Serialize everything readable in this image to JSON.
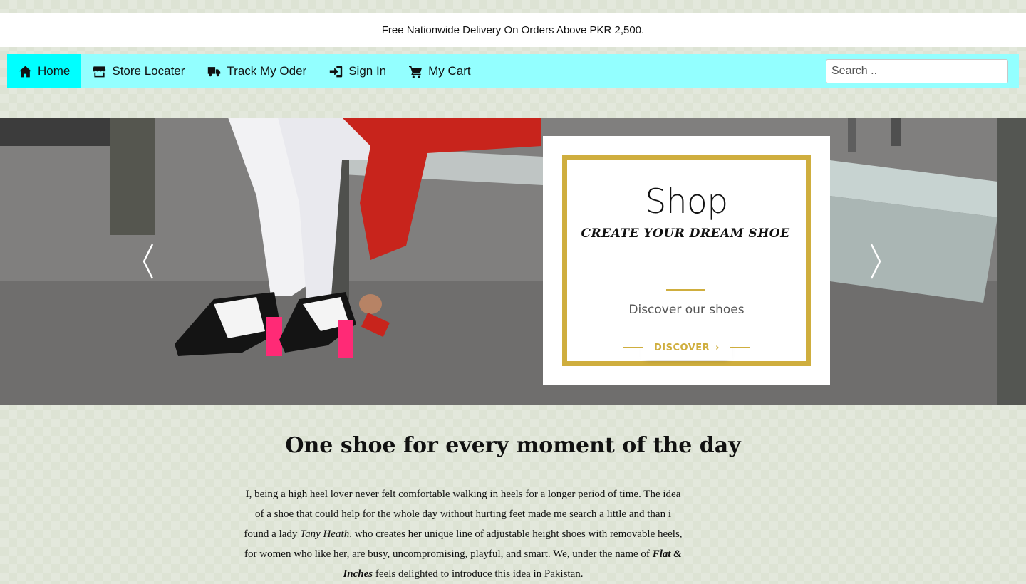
{
  "promo_bar": {
    "text": "Free Nationwide Delivery On Orders Above PKR 2,500."
  },
  "nav": {
    "items": [
      {
        "label": "Home",
        "icon": "home-icon",
        "active": true
      },
      {
        "label": "Store Locater",
        "icon": "store-icon",
        "active": false
      },
      {
        "label": "Track My Oder",
        "icon": "truck-icon",
        "active": false
      },
      {
        "label": "Sign In",
        "icon": "sign-in-icon",
        "active": false
      },
      {
        "label": "My Cart",
        "icon": "cart-icon",
        "active": false
      }
    ],
    "search_placeholder": "Search .."
  },
  "hero": {
    "card": {
      "title": "Shop",
      "subtitle": "CREATE YOUR DREAM SHOE",
      "text": "Discover our shoes",
      "button_label": "DISCOVER"
    },
    "arrows": {
      "prev_icon": "chevron-left-icon",
      "next_icon": "chevron-right-icon"
    }
  },
  "content": {
    "title": "One shoe for every moment of the day",
    "paragraph": {
      "part1": "I, being a high heel lover never felt comfortable walking in heels for a longer period of time. The idea of a shoe that could help for the whole day without hurting feet made me search a little and than i found a lady ",
      "name": "Tany Heath",
      "part2": ". who creates her unique line of adjustable height shoes with removable heels, for women who like her, are busy, uncompromising, playful, and smart. We, under the name of ",
      "brand": "Flat & Inches",
      "part3": " feels delighted to introduce this idea in Pakistan."
    }
  },
  "colors": {
    "nav_bg": "#93ffff",
    "nav_active": "#00ffff",
    "accent_gold": "#cfae3e",
    "page_bg": "#dde3d4"
  }
}
